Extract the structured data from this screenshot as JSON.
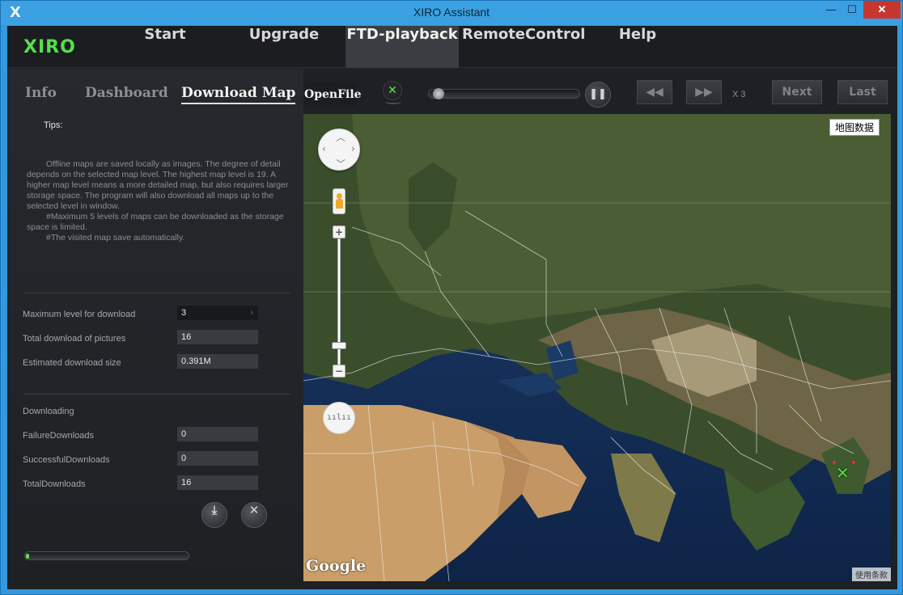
{
  "window": {
    "title": "XIRO Assistant",
    "app_icon": "X",
    "min_symbol": "—",
    "max_symbol": "☐",
    "close_symbol": "✕"
  },
  "nav": {
    "logo": "XIRO",
    "items": [
      "Start",
      "Upgrade",
      "FTD-playback",
      "RemoteControl",
      "Help"
    ],
    "active": "FTD-playback"
  },
  "subtabs": {
    "info": "Info",
    "dashboard": "Dashboard",
    "download_map": "Download Map",
    "active": "Download Map"
  },
  "tips": {
    "title": "Tips:",
    "paragraph1": "Offline maps are saved locally as images. The degree of detail depends on the selected map level. The highest map level is 19. A higher map level means a more detailed map, but also requires larger storage space. The program will also download all maps up to the selected level in window.",
    "paragraph2": "#Maximum 5 levels of maps can be downloaded as the storage space is limited.",
    "paragraph3": "#The visited map save automatically."
  },
  "download_settings": {
    "max_level_label": "Maximum level for download",
    "max_level_value": "3",
    "total_pictures_label": "Total download of pictures",
    "total_pictures_value": "16",
    "estimated_size_label": "Estimated download size",
    "estimated_size_value": "0.391M"
  },
  "downloading": {
    "title": "Downloading",
    "failure_label": "FailureDownloads",
    "failure_value": "0",
    "success_label": "SuccessfulDownloads",
    "success_value": "0",
    "total_label": "TotalDownloads",
    "total_value": "16",
    "progress_fraction": 0.01,
    "download_symbol": "⤓",
    "cancel_symbol": "✕"
  },
  "player": {
    "open_file": "OpenFile",
    "status_symbol": "✕",
    "pause_symbol": "❚❚",
    "rewind_symbol": "◀◀",
    "forward_symbol": "▶▶",
    "speed": "X 3",
    "next": "Next",
    "last": "Last",
    "seek_fraction": 0.02
  },
  "map": {
    "provider_label": "地图数据",
    "google_logo": "Google",
    "terms": "使用条款",
    "zoom_in": "+",
    "zoom_out": "−",
    "scale_icon": "ıılıı",
    "marker_symbol": "✕"
  },
  "colors": {
    "accent_green": "#55e04a",
    "close_red": "#c7372f",
    "titlebar_blue": "#3aa0e2"
  }
}
